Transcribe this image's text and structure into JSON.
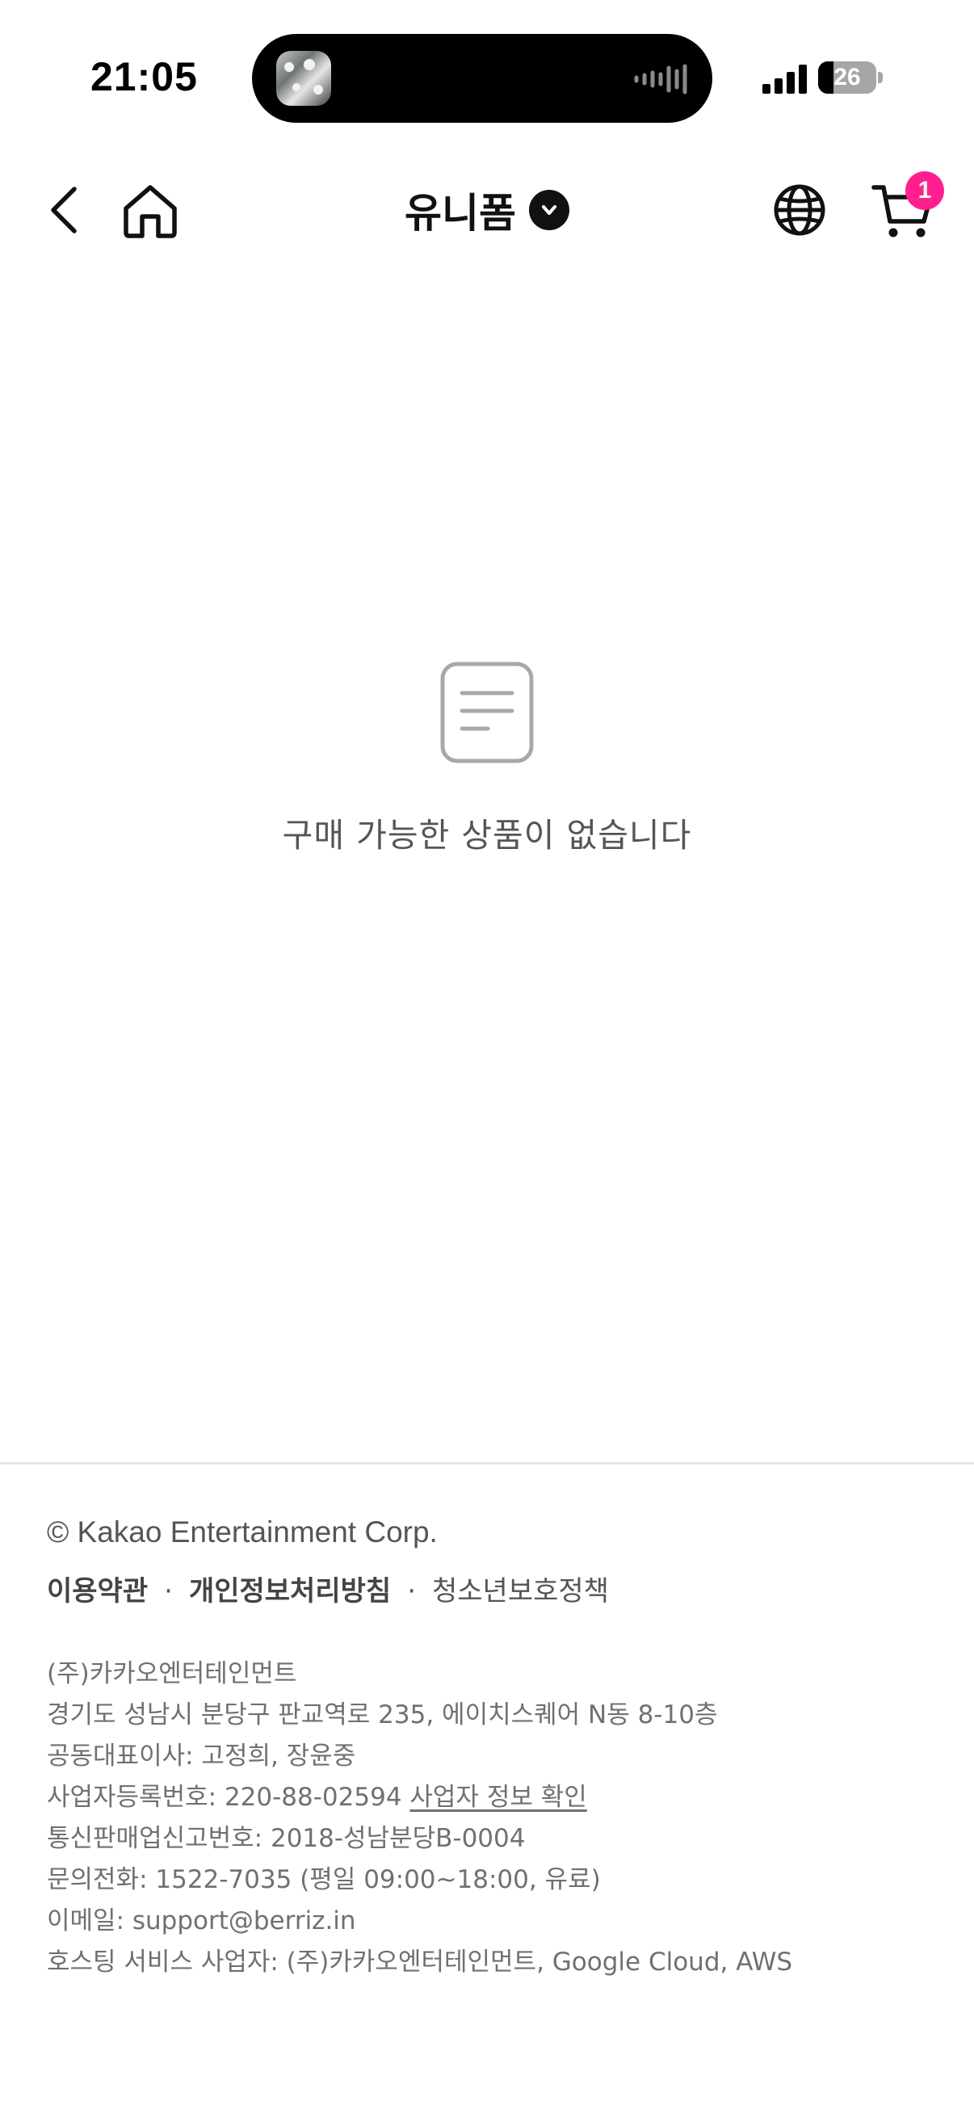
{
  "status_bar": {
    "time": "21:05",
    "battery_level": "26",
    "battery_fraction": 0.26,
    "icons": [
      "now-playing-thumbnail",
      "audio-waveform-icon",
      "cellular-signal-icon",
      "battery-icon"
    ]
  },
  "header": {
    "title": "유니폼",
    "icons": [
      "back-icon",
      "home-icon",
      "chevron-down-icon",
      "globe-icon",
      "cart-icon"
    ],
    "cart_count": "1",
    "badge_color": "#ff1f8e"
  },
  "empty_state": {
    "icon": "document-icon",
    "message": "구매 가능한 상품이 없습니다"
  },
  "footer": {
    "copyright": "© Kakao Entertainment Corp.",
    "links": [
      {
        "label": "이용약관"
      },
      {
        "label": "개인정보처리방침"
      },
      {
        "label": "청소년보호정책"
      }
    ],
    "separator": "·",
    "company_name": "(주)카카오엔터테인먼트",
    "address": "경기도 성남시 분당구 판교역로 235, 에이치스퀘어 N동 8-10층",
    "ceo": "공동대표이사: 고정희, 장윤중",
    "business_number": "사업자등록번호: 220-88-02594",
    "business_info_link": "사업자 정보 확인",
    "mail_order_number": "통신판매업신고번호: 2018-성남분당B-0004",
    "phone": "문의전화: 1522-7035 (평일 09:00~18:00, 유료)",
    "email": "이메일: support@berriz.in",
    "hosting": "호스팅 서비스 사업자: (주)카카오엔터테인먼트, Google Cloud, AWS"
  }
}
